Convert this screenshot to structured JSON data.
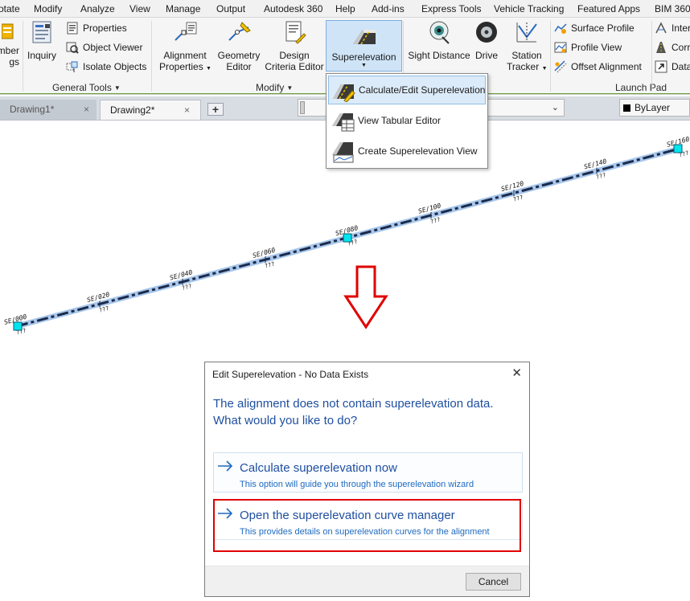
{
  "menu": [
    "otate",
    "Modify",
    "Analyze",
    "View",
    "Manage",
    "Output",
    "Autodesk 360",
    "Help",
    "Add-ins",
    "Express Tools",
    "Vehicle Tracking",
    "Featured Apps",
    "BIM 360"
  ],
  "ribbon": {
    "cut_label_line1": "mber",
    "cut_label_line2": "gs",
    "inquiry": "Inquiry",
    "properties": "Properties",
    "object_viewer": "Object Viewer",
    "isolate_objects": "Isolate Objects",
    "general_tools": "General Tools",
    "alignment_properties_1": "Alignment",
    "alignment_properties_2": "Properties",
    "geometry_editor_1": "Geometry",
    "geometry_editor_2": "Editor",
    "design_criteria_1": "Design",
    "design_criteria_2": "Criteria Editor",
    "modify": "Modify",
    "superelevation": "Superelevation",
    "sight_distance": "Sight Distance",
    "drive": "Drive",
    "station_tracker_1": "Station",
    "station_tracker_2": "Tracker",
    "surface_profile": "Surface Profile",
    "profile_view": "Profile View",
    "offset_alignment": "Offset Alignment",
    "launch_pad": "Launch Pad",
    "inter": "Inter",
    "corri": "Corri",
    "data": "Data"
  },
  "superelevation_menu": {
    "calculate_edit": "Calculate/Edit Superelevation",
    "tabular_editor": "View Tabular Editor",
    "create_view": "Create Superelevation View"
  },
  "tabs": {
    "drawing1": "Drawing1*",
    "drawing2": "Drawing2*",
    "close": "×",
    "new": "+"
  },
  "layer": "ByLayer",
  "stations": [
    "SE/000",
    "SE/020",
    "SE/040",
    "SE/060",
    "SE/080",
    "SE/100",
    "SE/120",
    "SE/140",
    "SE/160"
  ],
  "station_sub": "???",
  "dialog": {
    "title": "Edit Superelevation - No Data Exists",
    "close": "✕",
    "message_line1": "The alignment does not contain superelevation data.",
    "message_line2": "What would you like to do?",
    "option1_title": "Calculate superelevation now",
    "option1_desc": "This option will guide you through the superelevation wizard",
    "option2_title": "Open the superelevation curve manager",
    "option2_desc": "This provides details on superelevation curves for the alignment",
    "cancel": "Cancel"
  },
  "colors": {
    "accent_blue": "#1f4fa0",
    "highlight_red": "#e00000",
    "alignment_line": "#1c2a4a",
    "alignment_glow": "#a9c8ec",
    "grip": "#00e5f0",
    "arrow_red": "#e00000"
  }
}
